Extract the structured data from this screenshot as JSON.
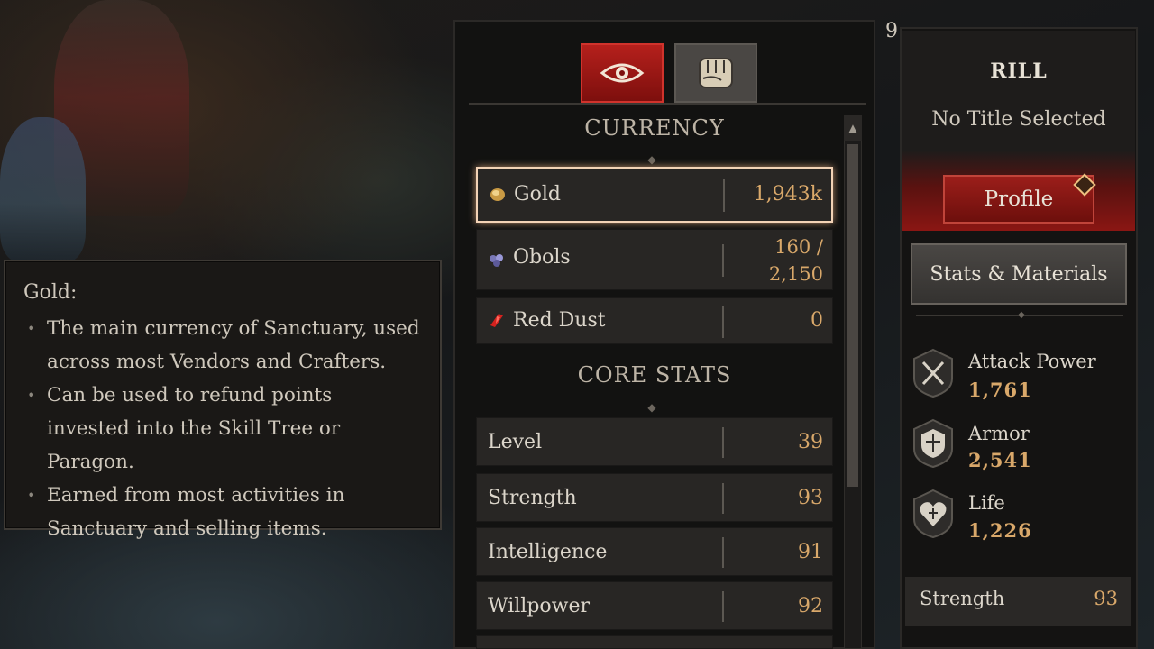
{
  "tooltip": {
    "title": "Gold:",
    "bullets": [
      "The main currency of Sanctuary, used across most Vendors and Crafters.",
      "Can be used to refund points invested into the Skill Tree or Paragon.",
      "Earned from most activities in Sanctuary and selling items."
    ]
  },
  "tabs": [
    {
      "icon": "eye-icon",
      "active": true
    },
    {
      "icon": "fist-icon",
      "active": false
    }
  ],
  "currency": {
    "header": "CURRENCY",
    "rows": [
      {
        "label": "Gold",
        "value": "1,943k",
        "icon": "gold-coin-icon"
      },
      {
        "label": "Obols",
        "value_line1": "160 /",
        "value_line2": "2,150",
        "icon": "obols-icon"
      },
      {
        "label": "Red Dust",
        "value": "0",
        "icon": "red-dust-icon"
      }
    ]
  },
  "core_stats": {
    "header": "CORE STATS",
    "rows": [
      {
        "label": "Level",
        "value": "39"
      },
      {
        "label": "Strength",
        "value": "93"
      },
      {
        "label": "Intelligence",
        "value": "91"
      },
      {
        "label": "Willpower",
        "value": "92"
      }
    ]
  },
  "character": {
    "level": "9",
    "name": "RILL",
    "title": "No Title Selected",
    "profile_label": "Profile",
    "stats_materials_label": "Stats & Materials",
    "stats": [
      {
        "name": "Attack Power",
        "value": "1,761",
        "icon": "crossed-swords-icon"
      },
      {
        "name": "Armor",
        "value": "2,541",
        "icon": "shield-icon"
      },
      {
        "name": "Life",
        "value": "1,226",
        "icon": "heart-icon"
      }
    ],
    "bottom_row": {
      "label": "Strength",
      "value": "93"
    }
  },
  "colors": {
    "accent_red": "#b5201c",
    "value_gold": "#d9a86a",
    "highlight_border": "#f3d3b6"
  }
}
